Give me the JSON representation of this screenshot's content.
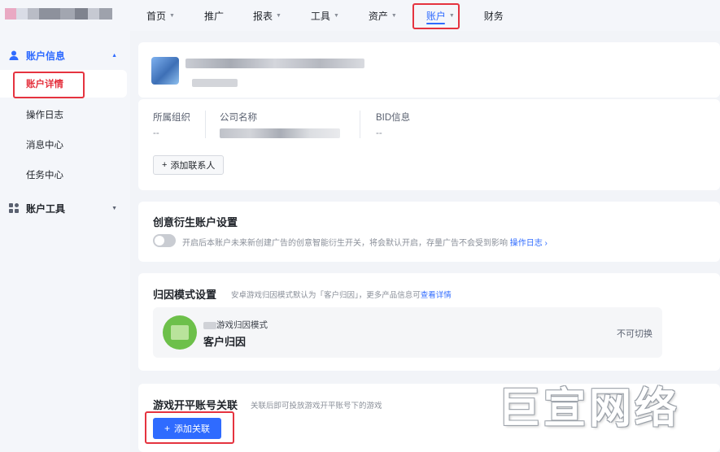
{
  "nav": {
    "items": [
      {
        "label": "首页",
        "has_caret": true
      },
      {
        "label": "推广",
        "has_caret": false
      },
      {
        "label": "报表",
        "has_caret": true
      },
      {
        "label": "工具",
        "has_caret": true
      },
      {
        "label": "资产",
        "has_caret": true
      },
      {
        "label": "账户",
        "has_caret": true
      },
      {
        "label": "财务",
        "has_caret": false
      }
    ],
    "active": "账户"
  },
  "sidebar": {
    "group1": {
      "label": "账户信息",
      "icon": "user-icon"
    },
    "items": [
      {
        "label": "账户详情"
      },
      {
        "label": "操作日志"
      },
      {
        "label": "消息中心"
      },
      {
        "label": "任务中心"
      }
    ],
    "group2": {
      "label": "账户工具",
      "icon": "grid-icon"
    }
  },
  "account": {
    "fields": [
      {
        "label": "所属组织",
        "value": "--"
      },
      {
        "label": "公司名称",
        "value": ""
      },
      {
        "label": "BID信息",
        "value": "--"
      }
    ],
    "add_contact": "添加联系人",
    "add_symbol": "+"
  },
  "creative": {
    "title": "创意衍生账户设置",
    "desc": "开启后本账户未来新创建广告的创意智能衍生开关，将会默认开启，存量广告不会受到影响",
    "log_link": "操作日志 ›"
  },
  "attribution": {
    "title": "归因模式设置",
    "desc": "安卓游戏归因模式默认为「客户归因」，更多产品信息可",
    "detail_link": "查看详情",
    "mode_caption": "游戏归因模式",
    "mode_value": "客户归因",
    "status": "不可切换"
  },
  "game_link": {
    "title": "游戏开平账号关联",
    "desc": "关联后即可投放游戏开平账号下的游戏",
    "button": "添加关联",
    "add_symbol": "+"
  },
  "watermark": "巨宣网络",
  "colors": {
    "accent": "#2f6bff",
    "highlight": "#e5333f",
    "sidebar_bg": "#f4f6fa"
  }
}
